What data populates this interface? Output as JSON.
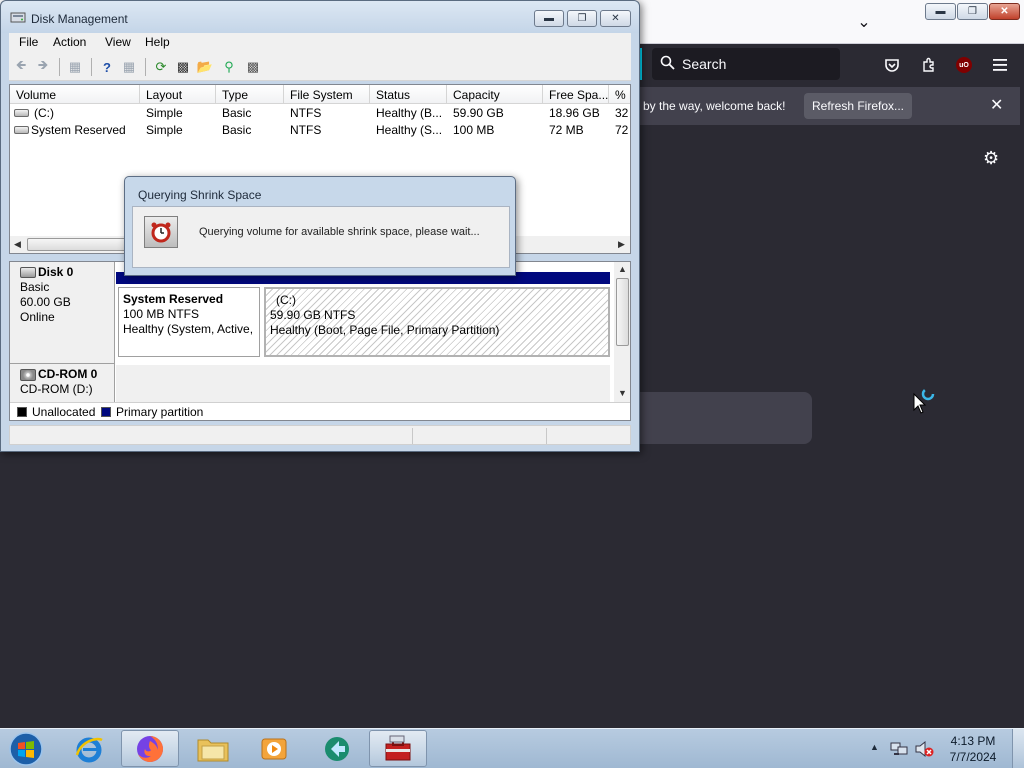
{
  "firefox": {
    "search_placeholder": "Search",
    "notification_text": "by the way, welcome back!",
    "refresh_button": "Refresh Firefox...",
    "ublock_label": "uO",
    "icons": {
      "tab_list": "chevron-down-icon",
      "search": "search-icon",
      "pocket": "pocket-icon",
      "extensions": "puzzle-icon",
      "menu": "hamburger-icon",
      "settings": "gear-icon",
      "close": "close-icon"
    }
  },
  "disk_management": {
    "title": "Disk Management",
    "menu": [
      "File",
      "Action",
      "View",
      "Help"
    ],
    "columns": [
      "Volume",
      "Layout",
      "Type",
      "File System",
      "Status",
      "Capacity",
      "Free Spa...",
      "% F"
    ],
    "volumes": [
      {
        "volume": "(C:)",
        "layout": "Simple",
        "type": "Basic",
        "fs": "NTFS",
        "status": "Healthy (B...",
        "capacity": "59.90 GB",
        "free": "18.96 GB",
        "pct": "32"
      },
      {
        "volume": "System Reserved",
        "layout": "Simple",
        "type": "Basic",
        "fs": "NTFS",
        "status": "Healthy (S...",
        "capacity": "100 MB",
        "free": "72 MB",
        "pct": "72"
      }
    ],
    "disks": [
      {
        "name": "Disk 0",
        "kind": "Basic",
        "size": "60.00 GB",
        "state": "Online"
      },
      {
        "name": "CD-ROM 0",
        "kind": "CD-ROM (D:)"
      }
    ],
    "partitions": [
      {
        "name": "System Reserved",
        "size": "100 MB NTFS",
        "status": "Healthy (System, Active,"
      },
      {
        "name": "(C:)",
        "size": "59.90 GB NTFS",
        "status": "Healthy (Boot, Page File, Primary Partition)"
      }
    ],
    "legend": [
      {
        "label": "Unallocated",
        "color": "#000000"
      },
      {
        "label": "Primary partition",
        "color": "#00087e"
      }
    ]
  },
  "dialog": {
    "title": "Querying Shrink Space",
    "message": "Querying volume for available shrink space, please wait..."
  },
  "taskbar": {
    "time": "4:13 PM",
    "date": "7/7/2024"
  }
}
